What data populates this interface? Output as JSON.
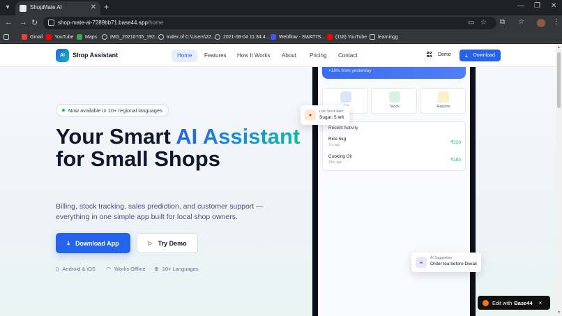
{
  "browser": {
    "tab_title": "ShopMate AI",
    "new_tab": "+",
    "url_host": "shop-mate-ai-7289bb71.base44.app",
    "url_path": "/home",
    "bookmarks": [
      "Gmail",
      "YouTube",
      "Maps",
      "IMG_20210705_192...",
      "Index of C:\\Users\\22...",
      "2021-08-04 11:34:4...",
      "Webflow - SWATI'S...",
      "(118) YouTube",
      "learningg"
    ]
  },
  "header": {
    "logo_badge": "AI",
    "logo_text": "Shop Assistant",
    "nav": [
      "Home",
      "Features",
      "How It Works",
      "About",
      "Pricing",
      "Contact"
    ],
    "demo": "Demo",
    "download": "Download"
  },
  "hero": {
    "badge": "Now available in 10+ regional languages",
    "title_1": "Your Smart ",
    "title_accent": "AI Assistant",
    "title_2": " for Small Shops",
    "subtitle": "Billing, stock tracking, sales prediction, and customer support — everything in one simple app built for local shop owners.",
    "primary_cta": "Download App",
    "secondary_cta": "Try Demo",
    "features": [
      "Android & iOS",
      "Works Offline",
      "10+ Languages"
    ]
  },
  "phone": {
    "growth": "+18% from yesterday",
    "tiles": [
      "Bill",
      "Stock",
      "Reports"
    ],
    "activity_title": "Recent Activity",
    "activity": [
      {
        "name": "Rice 5kg",
        "time": "2m ago",
        "amount": "₹320"
      },
      {
        "name": "Cooking Oil",
        "time": "15m ago",
        "amount": "₹180"
      }
    ]
  },
  "alert": {
    "kicker": "Low Stock Alert",
    "text": "Sugar: 5 left"
  },
  "suggestion": {
    "kicker": "AI Suggestion",
    "text": "Order tea before Diwali"
  },
  "base44": {
    "prefix": "Edit with",
    "brand": "Base44",
    "close": "×"
  },
  "colors": {
    "accent": "#2563eb",
    "teal": "#14b8a6",
    "success": "#10b981"
  }
}
